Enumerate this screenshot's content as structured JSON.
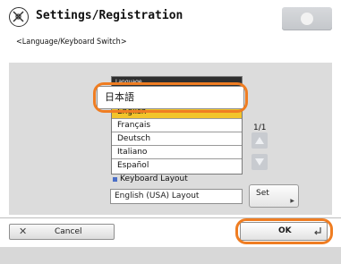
{
  "header": {
    "title": "Settings/Registration",
    "icon": "settings-registration-icon"
  },
  "breadcrumb": "<Language/Keyboard Switch>",
  "language": {
    "list_header": "Language",
    "current": "日本語",
    "options": [
      "English",
      "Français",
      "Deutsch",
      "Italiano",
      "Español"
    ],
    "selected_option": "English",
    "page": "1/1"
  },
  "keyboard": {
    "label": "Keyboard Layout",
    "value": "English (USA) Layout",
    "set_label": "Set"
  },
  "footer": {
    "cancel_label": "Cancel",
    "ok_label": "OK"
  },
  "colors": {
    "highlight": "#ef7d22",
    "selected_row": "#f2c42b",
    "panel": "#dcdcdc"
  }
}
